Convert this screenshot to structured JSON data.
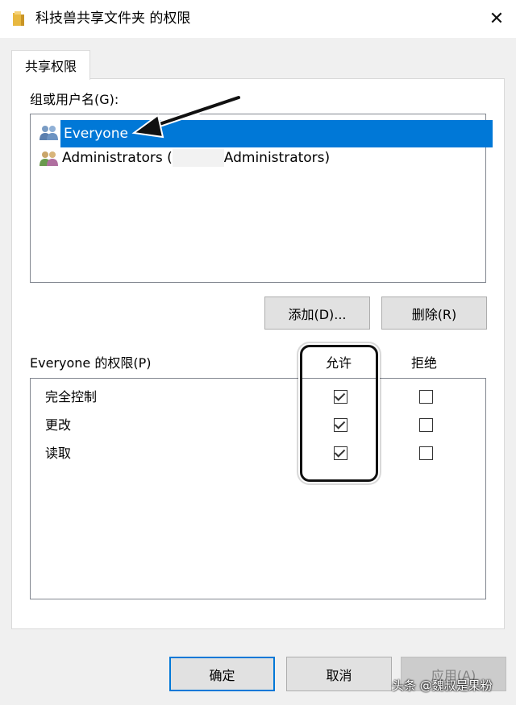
{
  "window": {
    "title": "科技兽共享文件夹 的权限",
    "close_glyph": "✕"
  },
  "tab": {
    "label": "共享权限"
  },
  "users_section": {
    "label": "组或用户名(G):",
    "items": [
      {
        "name": "Everyone",
        "selected": true,
        "icon": "users-icon"
      },
      {
        "name_prefix": "Administrators (",
        "name_suffix": "Administrators)",
        "selected": false,
        "icon": "users-icon"
      }
    ]
  },
  "buttons": {
    "add": "添加(D)...",
    "remove": "删除(R)",
    "ok": "确定",
    "cancel": "取消",
    "apply": "应用(A)"
  },
  "permissions": {
    "label": "Everyone 的权限(P)",
    "col_allow": "允许",
    "col_deny": "拒绝",
    "rows": [
      {
        "name": "完全控制",
        "allow": true,
        "deny": false
      },
      {
        "name": "更改",
        "allow": true,
        "deny": false
      },
      {
        "name": "读取",
        "allow": true,
        "deny": false
      }
    ]
  },
  "watermark": {
    "text": "头条 @魏叔是果粉"
  },
  "colors": {
    "selection": "#0078d7",
    "dialog_bg": "#f0f0f0",
    "primary_border": "#0078d7"
  }
}
